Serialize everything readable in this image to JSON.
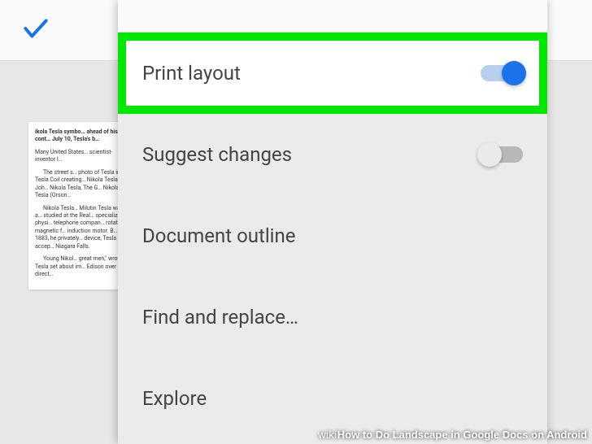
{
  "menu": {
    "items": [
      {
        "label": "Print layout",
        "toggle": "on"
      },
      {
        "label": "Suggest changes",
        "toggle": "off"
      },
      {
        "label": "Document outline",
        "toggle": null
      },
      {
        "label": "Find and replace…",
        "toggle": null
      },
      {
        "label": "Explore",
        "toggle": null
      }
    ]
  },
  "document_preview": {
    "p1": "ikola Tesla symbo… ahead of his cont… July 10, Tesla's b…",
    "p2": "Many United States… scientist-inventor I…",
    "p3": "The street s… photo of Tesla in t… Tesla Coil creating… Nikola Tesla by Joh… Nikola Tesla, The G… Nikola Tesla (Orson…",
    "p4": "Nikola Tesla… Milutin Tesla was a… studied at the Real… specialize in physi… telephone compan… rotating magnetic f… induction motor. B… 1883, he privately… device, Tesla accep… Niagara Falls.",
    "p5": "Young Nikol… great men,\" wrote… Tesla set about im… Edison over direct…"
  },
  "watermark": {
    "prefix": "wiki",
    "text": "How to Do Landscape in Google Docs on Android"
  }
}
